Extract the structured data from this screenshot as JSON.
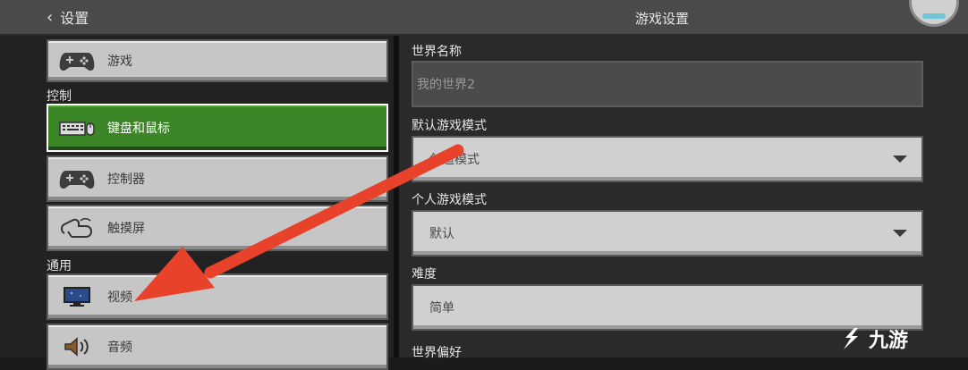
{
  "header": {
    "back_label": "设置",
    "title": "游戏设置"
  },
  "sidebar": {
    "items_top": [
      {
        "label": "游戏",
        "icon": "gamepad-icon"
      }
    ],
    "section_control": "控制",
    "items_control": [
      {
        "label": "键盘和鼠标",
        "icon": "keyboard-mouse-icon",
        "selected": true
      },
      {
        "label": "控制器",
        "icon": "gamepad-icon"
      },
      {
        "label": "触摸屏",
        "icon": "touch-icon"
      }
    ],
    "section_general": "通用",
    "items_general": [
      {
        "label": "视频",
        "icon": "monitor-icon"
      },
      {
        "label": "音频",
        "icon": "speaker-icon"
      }
    ]
  },
  "settings": {
    "world_name_label": "世界名称",
    "world_name_value": "我的世界2",
    "default_mode_label": "默认游戏模式",
    "default_mode_value": "创造模式",
    "personal_mode_label": "个人游戏模式",
    "personal_mode_value": "默认",
    "difficulty_label": "难度",
    "difficulty_value": "简单",
    "world_pref_label": "世界偏好"
  },
  "watermark": {
    "text": "九游"
  },
  "colors": {
    "selected_green": "#3c8527",
    "arrow_red": "#e8432a"
  }
}
